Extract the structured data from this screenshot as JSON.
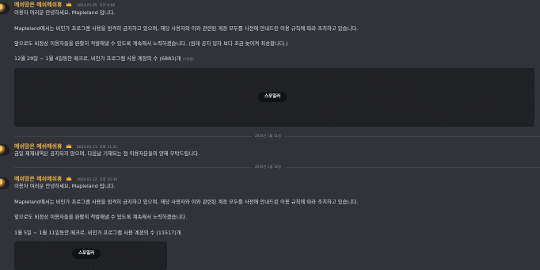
{
  "messages": [
    {
      "username": "메쉬망은 메쉬메쉬휴",
      "timestamp": "2024.01.05. 오전 9:06",
      "lines": [
        "이용자 여러분 안녕하세요, Mapleland 입니다.",
        "Mapleland에서는 비인가 프로그램 사용을 엄격히 금지하고 있으며, 해당 사용자와 이와 관련된 계정 모두를 사전에 안내드린 이용 규칙에 따라 조치하고 있습니다.",
        "앞으로도 비정상 이용자들을 완활히 적발해낼 수 있도록 계속해서 노력하겠습니다. (원래 공지 일자 보다 조금 늦어져 죄송합니다.)",
        "12월 29일 ~ 1월 4일동안 메크로, 비인가 프로그램 사용 계정의 수 (6883)개"
      ],
      "edited": "(수정됨)",
      "spoiler_label": "스포일러"
    },
    {
      "username": "메쉬망은 메쉬메쉬휴",
      "timestamp": "2024.01.11. 오후 11:21",
      "lines": [
        "금일 제재내역은 공지되지 않으며, 다음날 기재되는 점 이용자분들의 양해 부탁드립니다."
      ]
    },
    {
      "username": "메쉬망은 메쉬메쉬휴",
      "timestamp": "2024.01.12. 오후 10:30",
      "lines": [
        "이용자 여러분 안녕하세요, Mapleland 입니다.",
        "Mapleland에서는 비인가 프로그램 사용을 엄격히 금지하고 있으며, 해당 사용자와 이와 관련된 계정 모두를 사전에 안내드린 이용 규칙에 따라 조치하고 있습니다.",
        "앞으로도 비정상 이용자들을 완활히 적발해낼 수 있도록 계속해서 노력하겠습니다.",
        "1월 5일 ~ 1월 11일동안 메크로, 비인가 프로그램 사용 계정의 수 (11517)개"
      ],
      "spoiler_label": "스포일러"
    }
  ],
  "dividers": [
    "2024년 1월 11일",
    "2024년 1월 12일"
  ]
}
